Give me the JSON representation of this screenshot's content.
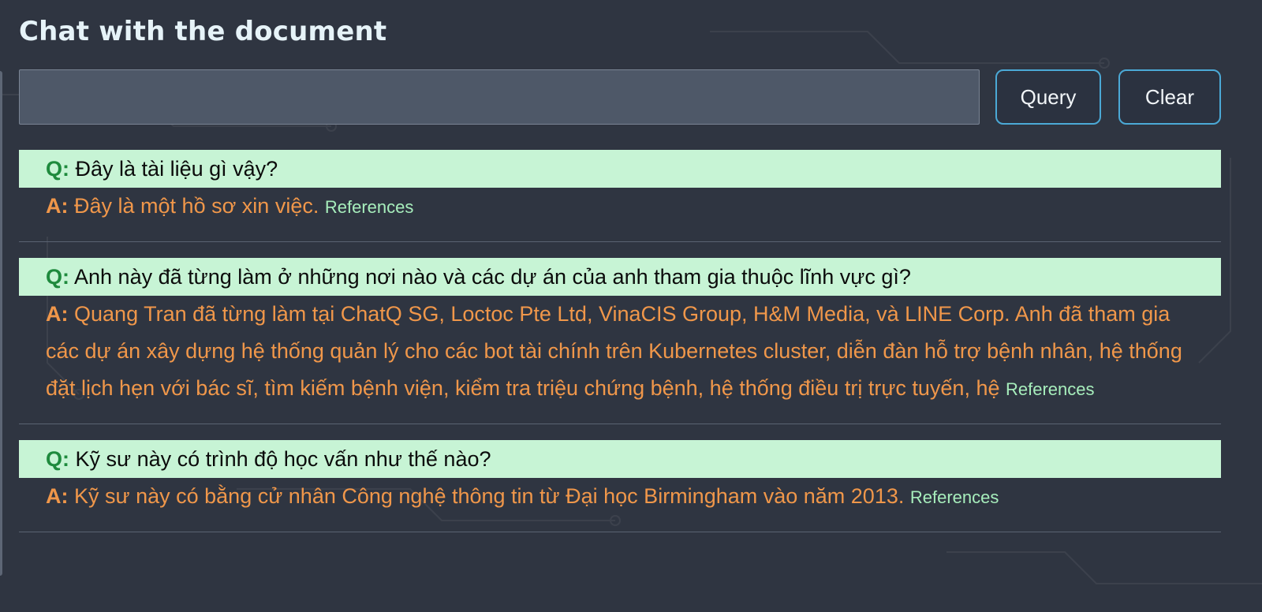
{
  "page": {
    "title": "Chat with the document"
  },
  "search": {
    "value": "",
    "placeholder": ""
  },
  "buttons": {
    "query_label": "Query",
    "clear_label": "Clear"
  },
  "labels": {
    "q_prefix": "Q:",
    "a_prefix": "A:",
    "references": "References"
  },
  "qa": [
    {
      "question": "Đây là tài liệu gì vậy?",
      "answer": "Đây là một hồ sơ xin việc."
    },
    {
      "question": "Anh này đã từng làm ở những nơi nào và các dự án của anh tham gia thuộc lĩnh vực gì?",
      "answer": "Quang Tran đã từng làm tại ChatQ SG, Loctoc Pte Ltd, VinaCIS Group, H&M Media, và LINE Corp. Anh đã tham gia các dự án xây dựng hệ thống quản lý cho các bot tài chính trên Kubernetes cluster, diễn đàn hỗ trợ bệnh nhân, hệ thống đặt lịch hẹn với bác sĩ, tìm kiếm bệnh viện, kiểm tra triệu chứng bệnh, hệ thống điều trị trực tuyến, hệ"
    },
    {
      "question": "Kỹ sư này có trình độ học vấn như thế nào?",
      "answer": "Kỹ sư này có bằng cử nhân Công nghệ thông tin từ Đại học Birmingham vào năm 2013."
    }
  ],
  "colors": {
    "background": "#2f3541",
    "question_bg": "#c7f4d5",
    "q_prefix": "#1e8a3d",
    "answer_text": "#f0974a",
    "references": "#a7eebc",
    "button_border": "#4ba9d6"
  }
}
